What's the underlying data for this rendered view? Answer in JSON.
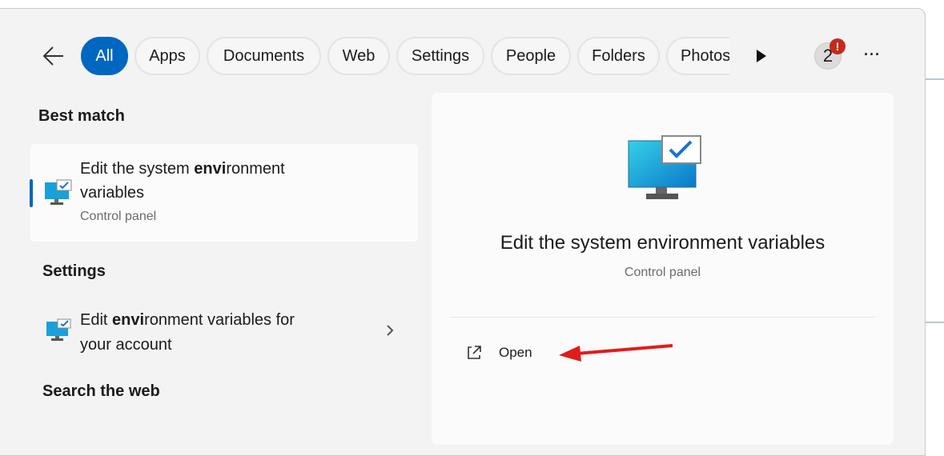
{
  "filters": {
    "tabs": [
      "All",
      "Apps",
      "Documents",
      "Web",
      "Settings",
      "People",
      "Folders",
      "Photos"
    ],
    "active": "All"
  },
  "header": {
    "badge_count": "2",
    "accent": "#0067c0",
    "badge_alert": "#c42b1c"
  },
  "best_match": {
    "heading": "Best match",
    "title_pre": "Edit the system ",
    "title_bold": "envi",
    "title_post": "ronment",
    "title_line2": "variables",
    "subtitle": "Control panel"
  },
  "settings": {
    "heading": "Settings",
    "item_pre": "Edit ",
    "item_bold": "envi",
    "item_post": "ronment variables for",
    "item_line2": "your account"
  },
  "search_web": {
    "heading": "Search the web"
  },
  "detail": {
    "title": "Edit the system environment variables",
    "subtitle": "Control panel",
    "open_label": "Open"
  }
}
